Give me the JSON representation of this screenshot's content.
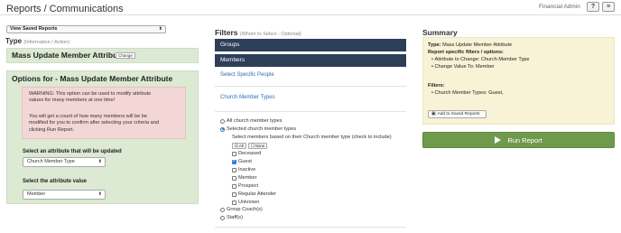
{
  "header": {
    "title": "Reports / Communications",
    "user_label": "Financial Admin",
    "help_icon": "?",
    "menu_icon": "≡"
  },
  "left": {
    "saved_reports_select": "View Saved Reports",
    "type_heading": "Type",
    "type_sub": "(Information / Action)",
    "selected_type": "Mass Update Member Attribute",
    "change_button": "Change",
    "options_title": "Options for - Mass Update Member Attribute",
    "warning_line1": "WARNING: This option can be used to modify attribute",
    "warning_line2": "values for many members at one time!",
    "warning_line3": "You will get a count of how many members will be be",
    "warning_line4": "modified for you to confirm after selecting your criteria and",
    "warning_line5": "clicking Run Report.",
    "attribute_label": "Select an attribute that will be updated",
    "attribute_value": "Church Member Type",
    "value_label": "Select the attribute value",
    "value_value": "Member"
  },
  "filters": {
    "heading": "Filters",
    "sub": "(Whom to Select - Optional)",
    "nav_groups": "Groups",
    "nav_members": "Members",
    "link_specific_people": "Select Specific People",
    "link_church_member_types": "Church Member Types",
    "radio_all": "All church member types",
    "radio_selected": "Selected church member types",
    "select_hint": "Select members based on their Church member type (check to include)",
    "btn_all": "All",
    "btn_none": "None",
    "types": [
      {
        "label": "Deceased",
        "checked": false
      },
      {
        "label": "Guest",
        "checked": true
      },
      {
        "label": "Inactive",
        "checked": false
      },
      {
        "label": "Member",
        "checked": false
      },
      {
        "label": "Prospect",
        "checked": false
      },
      {
        "label": "Regular Attender",
        "checked": false
      },
      {
        "label": "Unknown",
        "checked": false
      }
    ],
    "radio_group_coach": "Group Coach(s)",
    "radio_staff": "Staff(s)"
  },
  "summary": {
    "heading": "Summary",
    "type_label": "Type:",
    "type_value": "Mass Update Member Attribute",
    "specific_label": "Report specific filters / options:",
    "bullet1": "Attribute to Change: Church Member Type",
    "bullet2": "Change Value To: Member",
    "filters_label": "Filters:",
    "filter_bullet": "Church Member Types: Guest,",
    "add_saved_button": "Add to Saved Reports",
    "run_button": "Run Report"
  },
  "colors": {
    "nav_bar": "#2d3e59",
    "options_panel": "#dce9d3",
    "warning_box": "#f3d6d6",
    "summary_box": "#f8f2d6",
    "run_button": "#6f9a4c",
    "link": "#2a6ebb"
  }
}
